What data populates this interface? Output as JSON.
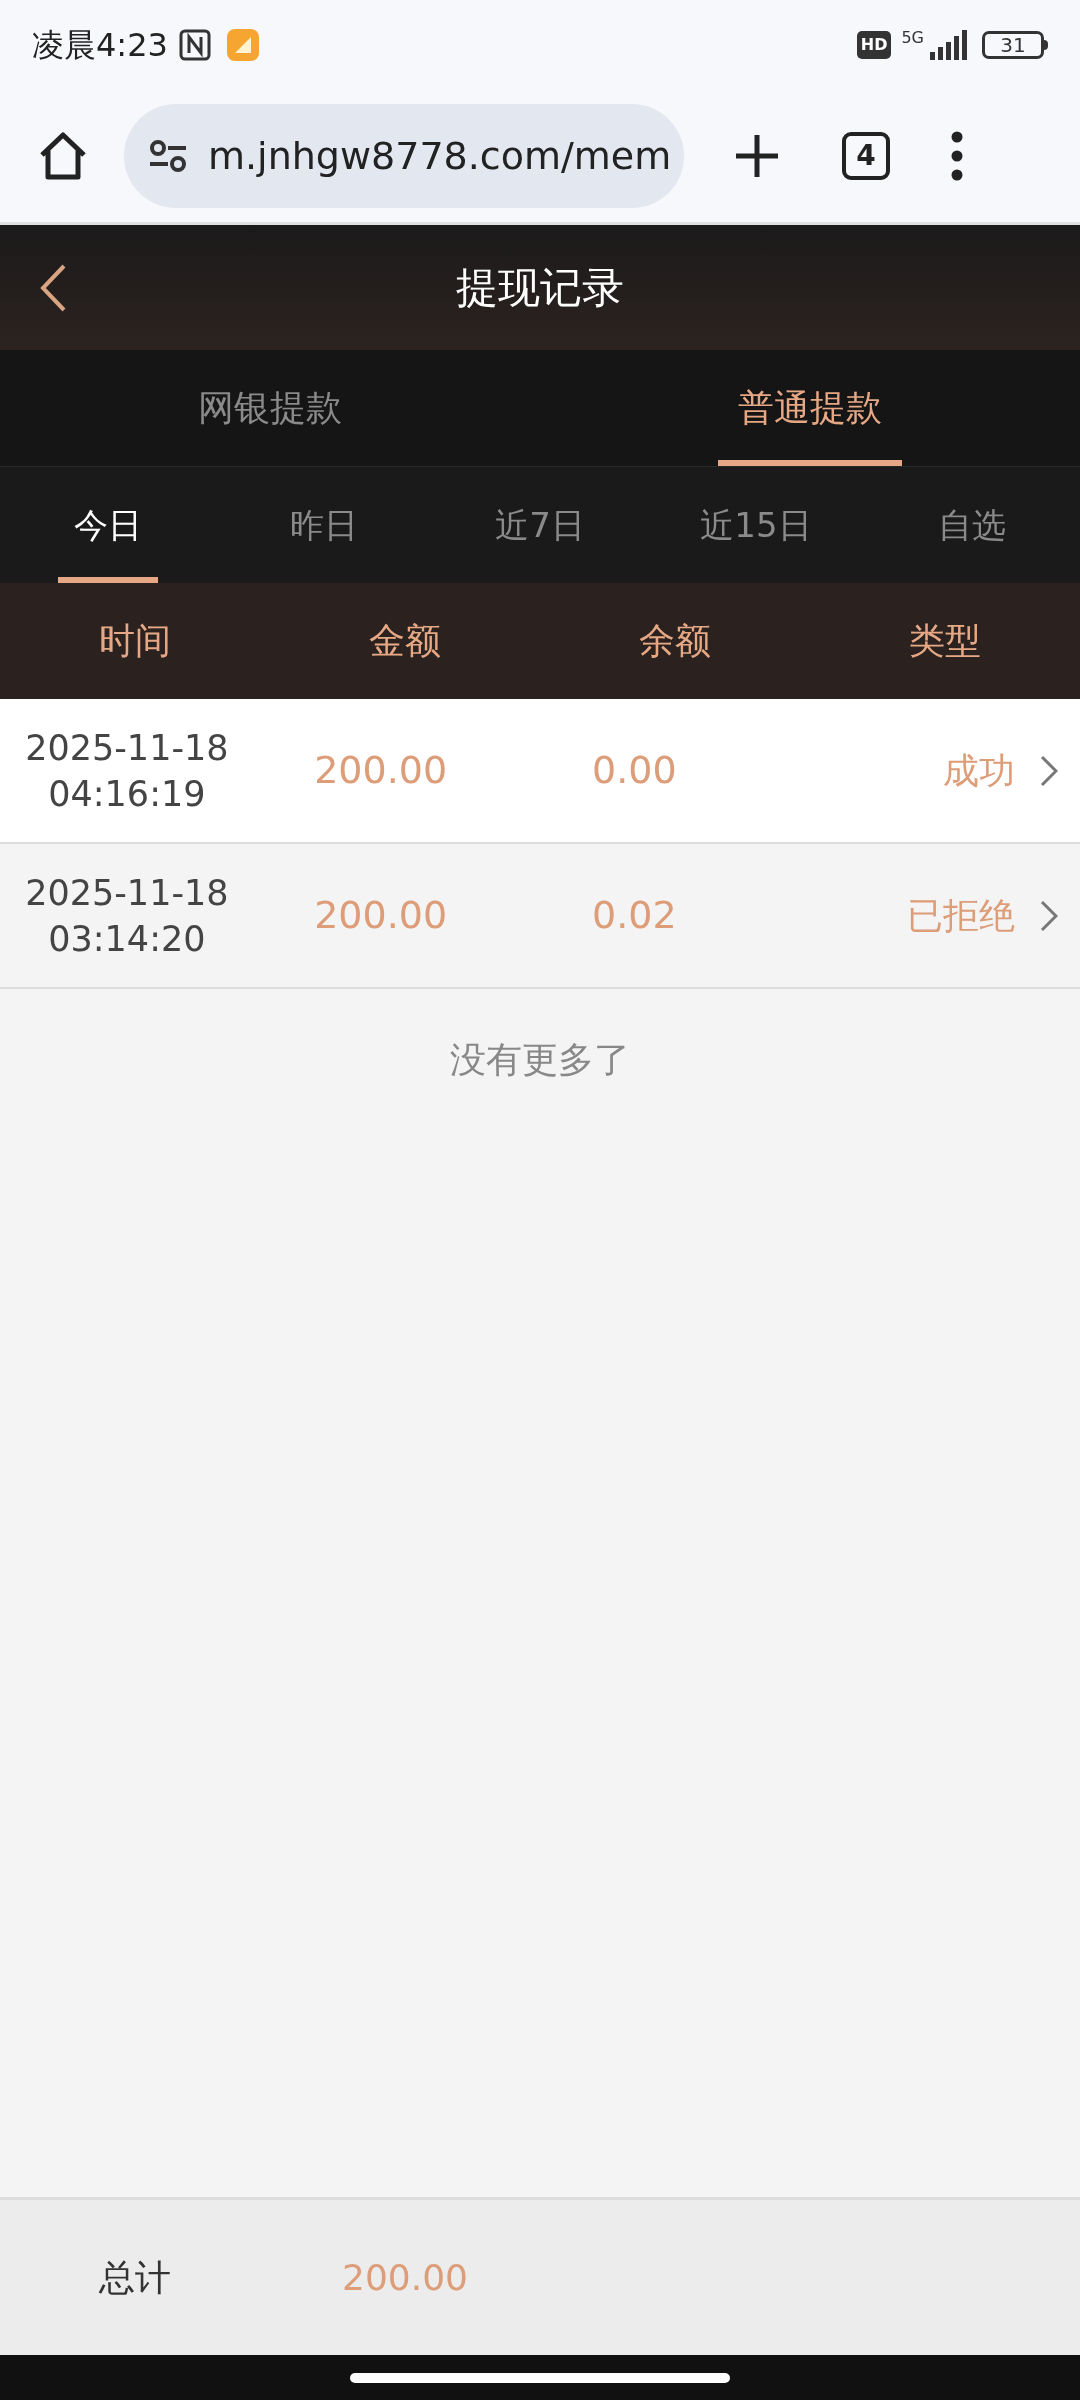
{
  "status_bar": {
    "time": "凌晨4:23",
    "hd": "HD",
    "network": "5G",
    "battery": "31"
  },
  "browser": {
    "url": "m.jnhgw8778.com/mem",
    "tab_count": "4"
  },
  "header": {
    "title": "提现记录"
  },
  "tabs": [
    {
      "label": "网银提款",
      "selected": false
    },
    {
      "label": "普通提款",
      "selected": true
    }
  ],
  "periods": [
    {
      "label": "今日",
      "selected": true
    },
    {
      "label": "昨日",
      "selected": false
    },
    {
      "label": "近7日",
      "selected": false
    },
    {
      "label": "近15日",
      "selected": false
    },
    {
      "label": "自选",
      "selected": false
    }
  ],
  "table": {
    "columns": [
      "时间",
      "金额",
      "余额",
      "类型"
    ],
    "rows": [
      {
        "date": "2025-11-18",
        "time": "04:16:19",
        "amount": "200.00",
        "balance": "0.00",
        "type": "成功"
      },
      {
        "date": "2025-11-18",
        "time": "03:14:20",
        "amount": "200.00",
        "balance": "0.02",
        "type": "已拒绝"
      }
    ],
    "end_note": "没有更多了"
  },
  "footer": {
    "label": "总计",
    "amount": "200.00"
  }
}
